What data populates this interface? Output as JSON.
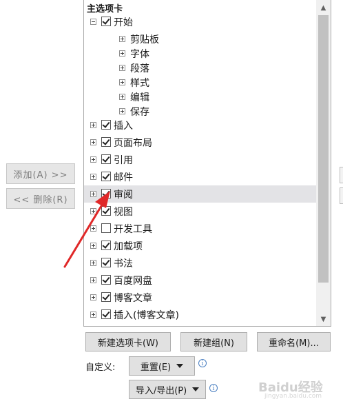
{
  "left_buttons": {
    "add_label": "添加(A) >>",
    "remove_label": "<< 删除(R)"
  },
  "tree": {
    "header": "主选项卡",
    "start_group": {
      "label": "开始",
      "checked": true,
      "expanded": true,
      "children": [
        "剪贴板",
        "字体",
        "段落",
        "样式",
        "编辑",
        "保存"
      ]
    },
    "items": [
      {
        "label": "插入",
        "checked": true
      },
      {
        "label": "页面布局",
        "checked": true
      },
      {
        "label": "引用",
        "checked": true
      },
      {
        "label": "邮件",
        "checked": true
      },
      {
        "label": "审阅",
        "checked": true,
        "selected": true
      },
      {
        "label": "视图",
        "checked": true
      },
      {
        "label": "开发工具",
        "checked": false
      },
      {
        "label": "加载项",
        "checked": true
      },
      {
        "label": "书法",
        "checked": true
      },
      {
        "label": "百度网盘",
        "checked": true
      },
      {
        "label": "博客文章",
        "checked": true
      },
      {
        "label": "插入(博客文章)",
        "checked": true
      }
    ]
  },
  "bottom": {
    "new_tab_label": "新建选项卡(W)",
    "new_group_label": "新建组(N)",
    "rename_label": "重命名(M)...",
    "customize_label": "自定义:",
    "reset_label": "重置(E)",
    "import_export_label": "导入/导出(P)"
  },
  "watermark": {
    "brand": "Baidu经验",
    "url": "jingyan.baidu.com"
  },
  "colors": {
    "selected_row": "#e3e3e6",
    "annotation_arrow": "#e02828",
    "info_icon": "#4a7fc1"
  }
}
